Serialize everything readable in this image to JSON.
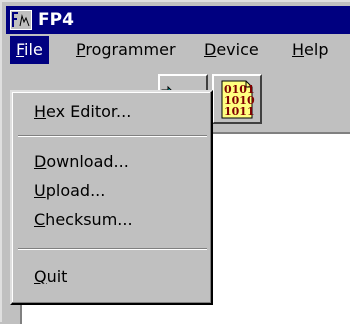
{
  "window": {
    "title": "FP4"
  },
  "menubar": {
    "file": {
      "mnemonic": "F",
      "rest": "ile"
    },
    "programmer": {
      "mnemonic": "P",
      "rest": "rogrammer"
    },
    "device": {
      "mnemonic": "D",
      "rest": "evice"
    },
    "help": {
      "mnemonic": "H",
      "rest": "elp"
    }
  },
  "file_menu": {
    "hex_editor": {
      "mnemonic": "H",
      "rest": "ex Editor..."
    },
    "download": {
      "mnemonic": "D",
      "rest": "ownload..."
    },
    "upload": {
      "mnemonic": "U",
      "rest": "pload..."
    },
    "checksum": {
      "mnemonic": "C",
      "rest": "hecksum..."
    },
    "quit": {
      "mnemonic": "Q",
      "rest": "uit"
    }
  },
  "toolbar": {
    "icons": [
      "open-folder-icon",
      "binary-data-icon"
    ],
    "binary_rows": [
      "0101",
      "1010",
      "1011"
    ]
  },
  "colors": {
    "titlebar": "#000080",
    "face": "#c0c0c0",
    "highlight": "#000080"
  }
}
